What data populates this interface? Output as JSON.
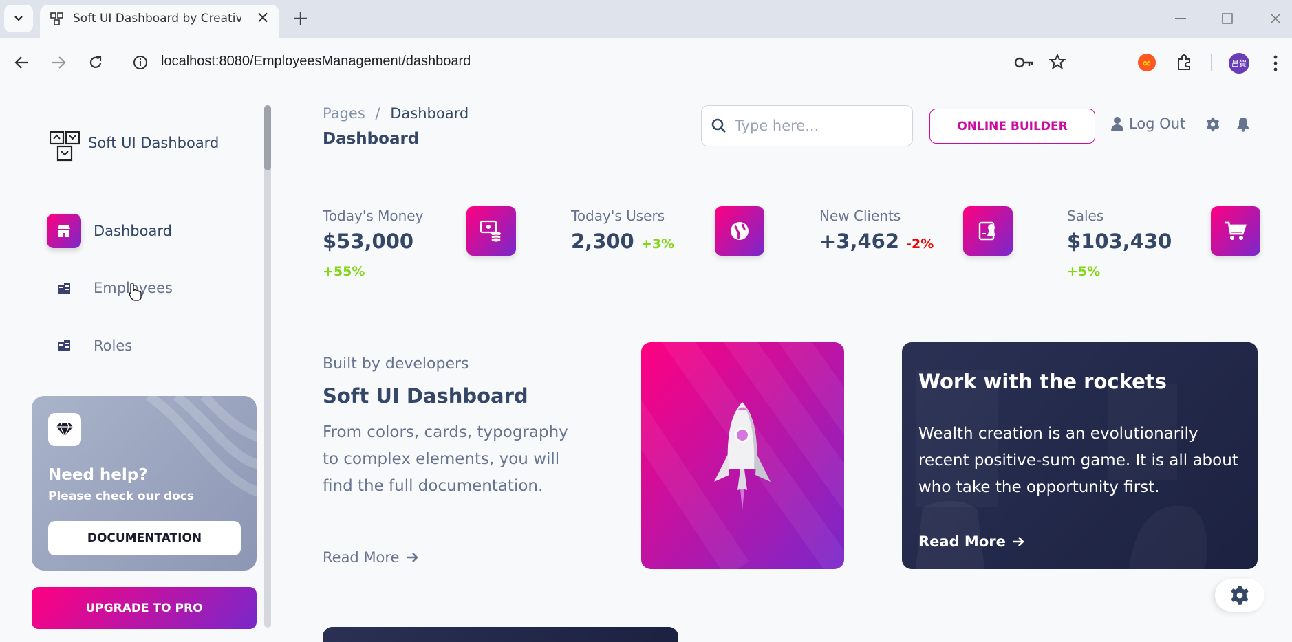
{
  "browser": {
    "tab_title": "Soft UI Dashboard by Creative Tim",
    "url": "localhost:8080/EmployeesManagement/dashboard",
    "profile_initials": "昌賀"
  },
  "sidebar": {
    "brand": "Soft UI Dashboard",
    "items": [
      {
        "label": "Dashboard",
        "active": true,
        "icon": "shop-icon"
      },
      {
        "label": "Employees",
        "active": false,
        "icon": "office-icon"
      },
      {
        "label": "Roles",
        "active": false,
        "icon": "office-icon"
      }
    ],
    "help": {
      "title": "Need help?",
      "subtitle": "Please check our docs",
      "button": "DOCUMENTATION"
    },
    "upgrade_button": "UPGRADE TO PRO"
  },
  "header": {
    "breadcrumb_root": "Pages",
    "breadcrumb_sep": "/",
    "breadcrumb_current": "Dashboard",
    "title": "Dashboard",
    "search_placeholder": "Type here...",
    "online_builder": "ONLINE BUILDER",
    "logout": "Log Out"
  },
  "stats": [
    {
      "label": "Today's Money",
      "value": "$53,000",
      "change": "+55%",
      "trend": "positive",
      "icon": "money-coins-icon"
    },
    {
      "label": "Today's Users",
      "value": "2,300",
      "change": "+3%",
      "trend": "positive",
      "icon": "world-icon"
    },
    {
      "label": "New Clients",
      "value": "+3,462",
      "change": "-2%",
      "trend": "negative",
      "icon": "paper-diploma-icon"
    },
    {
      "label": "Sales",
      "value": "$103,430",
      "change": "+5%",
      "trend": "positive",
      "icon": "cart-icon"
    }
  ],
  "promo": {
    "kicker": "Built by developers",
    "title": "Soft UI Dashboard",
    "description": "From colors, cards, typography to complex elements, you will find the full documentation.",
    "read_more": "Read More"
  },
  "rockets": {
    "title": "Work with the rockets",
    "description": "Wealth creation is an evolutionarily recent positive-sum game. It is all about who take the opportunity first.",
    "read_more": "Read More"
  },
  "colors": {
    "primary_gradient_start": "#ff0080",
    "primary_gradient_end": "#7928ca",
    "positive": "#82d616",
    "negative": "#ea0606",
    "text_dark": "#344767",
    "text_muted": "#67748e"
  }
}
